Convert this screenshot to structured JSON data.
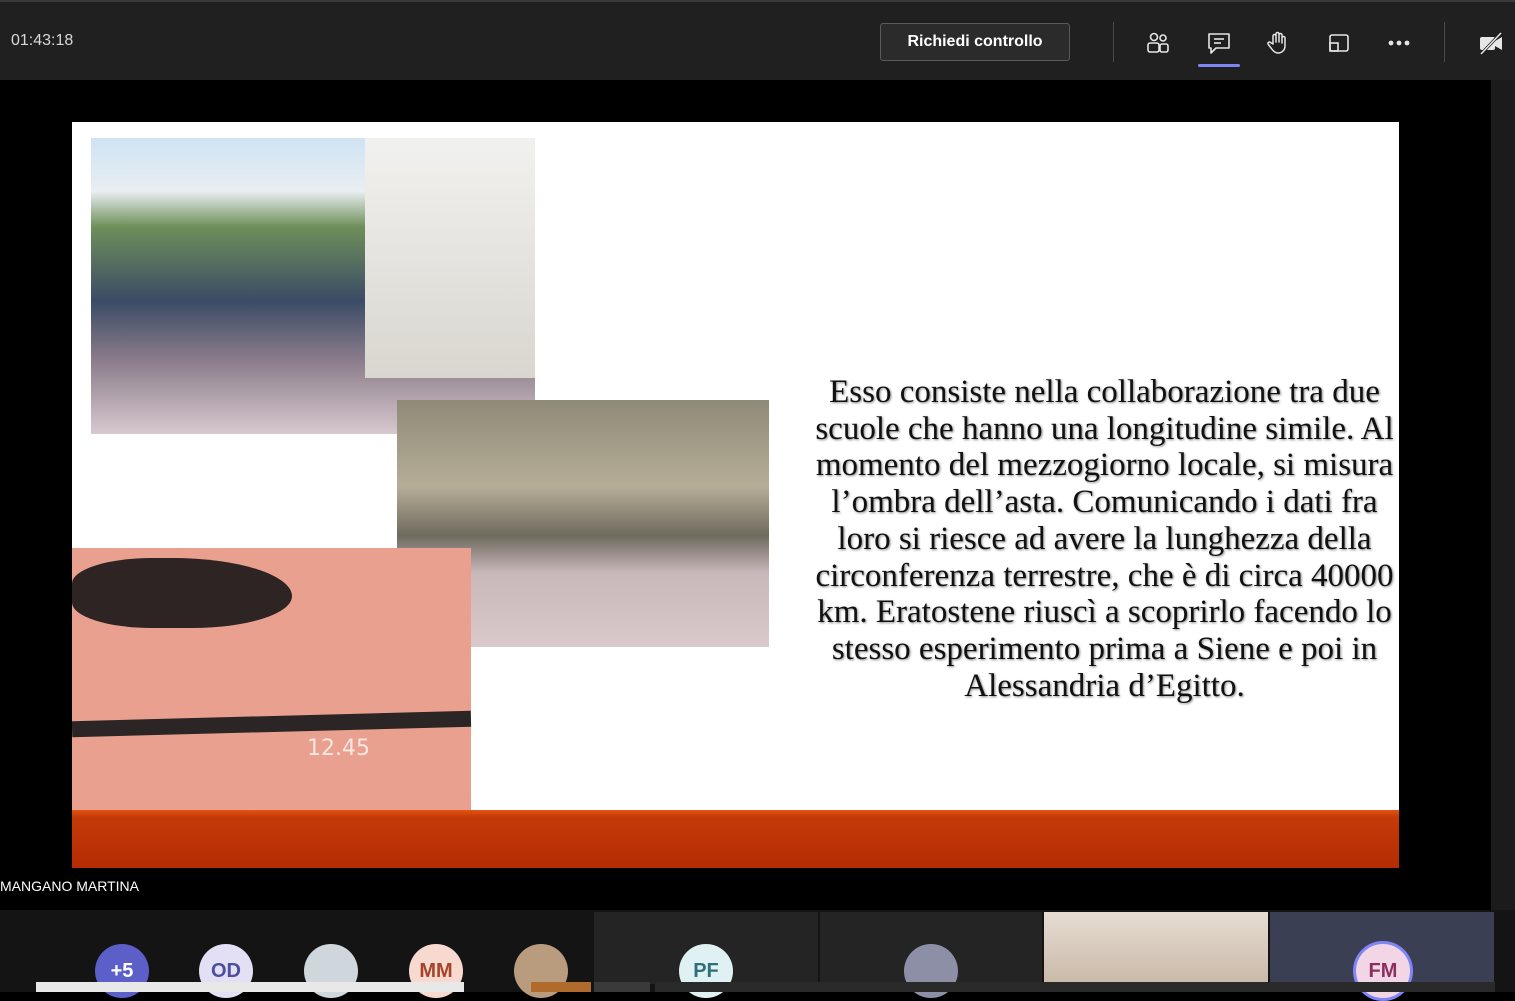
{
  "meeting": {
    "elapsed_time": "01:43:18"
  },
  "toolbar": {
    "request_control_label": "Richiedi controllo",
    "icons": [
      "people-icon",
      "chat-icon",
      "raise-hand-icon",
      "share-tray-icon",
      "more-icon",
      "camera-off-icon"
    ],
    "active_tool": "chat-icon",
    "accent_color": "#7f85f5"
  },
  "slide": {
    "text": "Esso consiste nella collaborazione tra due scuole che hanno una longitudine simile. Al momento del mezzogiorno locale, si misura l’ombra dell’asta. Comunicando i dati fra loro si riesce ad avere la lunghezza della circonferenza terrestre, che è di circa 40000 km. Eratostene riuscì a scoprirlo facendo lo stesso esperimento prima a Siene e poi in Alessandria d’Egitto.",
    "handwritten_time": "12.45",
    "footer_color": "#b52c04"
  },
  "speaker": {
    "name": "MANGANO MARTINA"
  },
  "participants": [
    {
      "initials": "+5",
      "bg": "#5b5fc7",
      "fg": "#ffffff"
    },
    {
      "initials": "OD",
      "bg": "#e3e0f5",
      "fg": "#4b4f9c"
    },
    {
      "initials": "",
      "bg": "#cfd6dc",
      "fg": "#333333",
      "photo": true
    },
    {
      "initials": "MM",
      "bg": "#f7d9cf",
      "fg": "#a3452b"
    },
    {
      "initials": "",
      "bg": "#b99b7d",
      "fg": "#333333",
      "photo": true
    },
    {
      "initials": "PF",
      "bg": "#e0f1f3",
      "fg": "#2f6f7a"
    },
    {
      "initials": "",
      "bg": "#8d8fa6",
      "fg": "#333333",
      "photo": true
    },
    {
      "initials": "FM",
      "bg": "#f3d6e6",
      "fg": "#8a2f5f"
    }
  ]
}
